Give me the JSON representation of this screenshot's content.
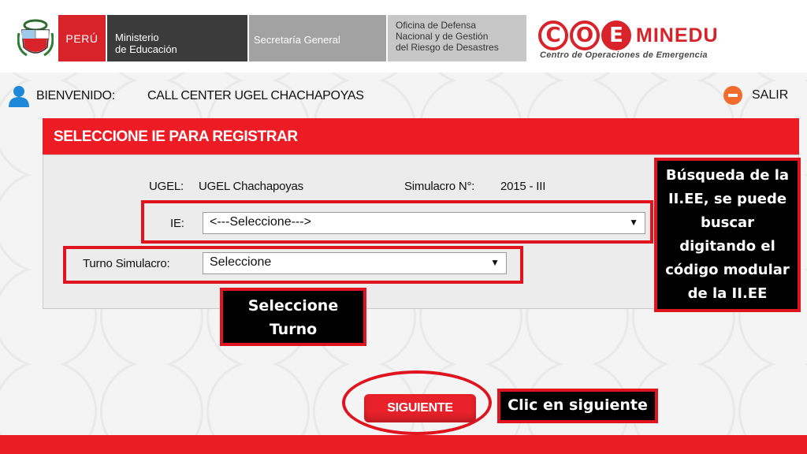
{
  "header": {
    "peru_label": "PERÚ",
    "ministerio_line1": "Ministerio",
    "ministerio_line2": "de Educación",
    "secretaria": "Secretaría General",
    "oficina_line1": "Oficina de Defensa",
    "oficina_line2": "Nacional y de Gestión",
    "oficina_line3": "del Riesgo de Desastres",
    "coe_letters": [
      "C",
      "O",
      "E"
    ],
    "coe_brand": "MINEDU",
    "coe_subtitle": "Centro de Operaciones de Emergencia",
    "brand_color": "#d9232a"
  },
  "userbar": {
    "welcome_label": "BIENVENIDO:",
    "username": "CALL CENTER UGEL CHACHAPOYAS",
    "logout_label": "SALIR"
  },
  "panel": {
    "title": "SELECCIONE IE PARA REGISTRAR",
    "ugel_label": "UGEL:",
    "ugel_value": "UGEL Chachapoyas",
    "simulacro_label": "Simulacro N°:",
    "simulacro_value": "2015 - III",
    "ie_label": "IE:",
    "ie_selected": "<---Seleccione--->",
    "turno_label": "Turno Simulacro:",
    "turno_selected": "Seleccione"
  },
  "annotations": {
    "busqueda_lines": [
      "Búsqueda de la",
      "II.EE, se puede",
      "buscar",
      "digitando el",
      "código modular",
      "de la II.EE"
    ],
    "turno_lines": [
      "Seleccione",
      "Turno"
    ],
    "siguiente_hint": "Clic en siguiente"
  },
  "actions": {
    "next_label": "SIGUIENTE"
  },
  "colors": {
    "accent_red": "#ed1c24",
    "panel_bg": "#ececec",
    "callout_bg": "#000000"
  }
}
